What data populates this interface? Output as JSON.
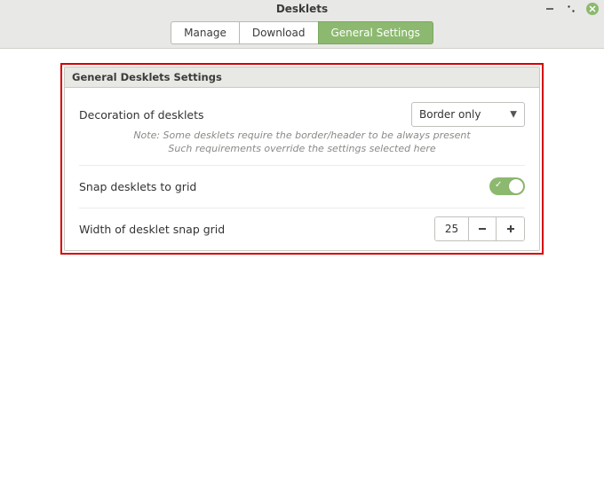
{
  "window": {
    "title": "Desklets"
  },
  "tabs": {
    "manage": "Manage",
    "download": "Download",
    "general": "General Settings",
    "active_index": 2
  },
  "panel": {
    "title": "General Desklets Settings",
    "decoration": {
      "label": "Decoration of desklets",
      "value": "Border only",
      "note1": "Note: Some desklets require the border/header to be always present",
      "note2": "Such requirements override the settings selected here"
    },
    "snap": {
      "label": "Snap desklets to grid",
      "enabled": true
    },
    "grid_width": {
      "label": "Width of desklet snap grid",
      "value": "25"
    }
  },
  "colors": {
    "accent": "#8cb96f",
    "highlight": "#d40000"
  }
}
